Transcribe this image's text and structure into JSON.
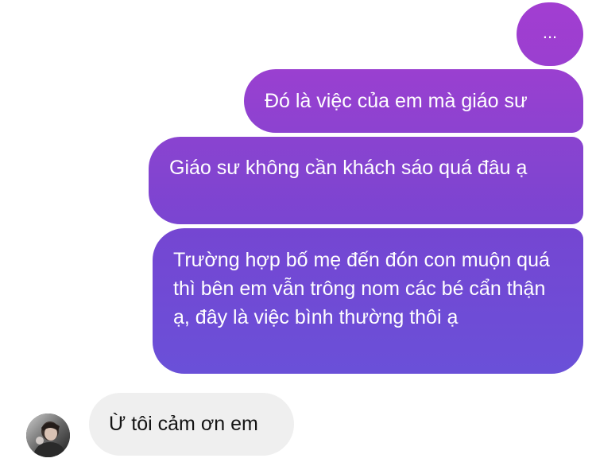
{
  "conversation": {
    "messages": [
      {
        "sender": "me",
        "text": "..."
      },
      {
        "sender": "me",
        "text": "Đó là việc của em mà giáo sư"
      },
      {
        "sender": "me",
        "text": "Giáo sư không cần khách sáo quá đâu ạ"
      },
      {
        "sender": "me",
        "text": "Trường hợp bố mẹ đến đón con muộn quá thì bên em vẫn trông nom các bé cẩn thận ạ, đây là việc bình thường thôi ạ"
      },
      {
        "sender": "contact",
        "text": "Ừ tôi cảm ơn em"
      }
    ]
  },
  "colors": {
    "outgoing_gradient_start": "#a23ed1",
    "outgoing_gradient_end": "#6a50d8",
    "incoming_bubble": "#efefef",
    "incoming_text": "#141414",
    "outgoing_text": "#ffffff"
  },
  "contact": {
    "avatar_icon": "profile-photo"
  }
}
